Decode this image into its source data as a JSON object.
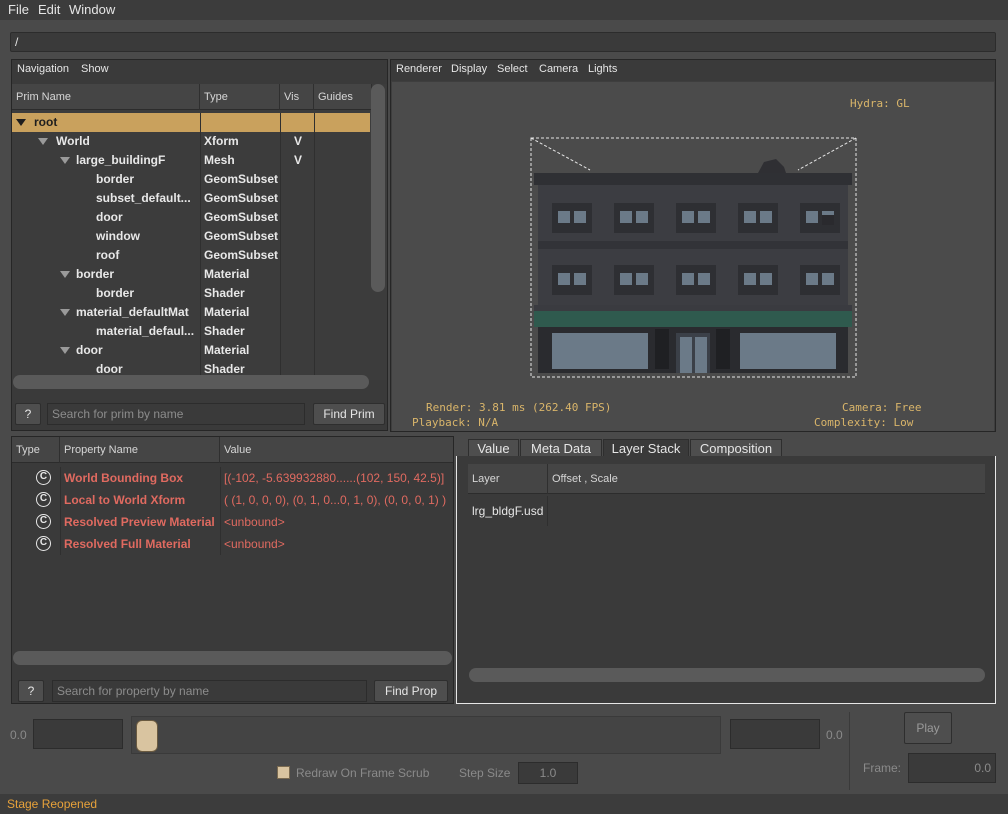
{
  "menubar": {
    "items": [
      "File",
      "Edit",
      "Window"
    ]
  },
  "path": "/",
  "prim_browser": {
    "menus": [
      "Navigation",
      "Show"
    ],
    "columns": [
      "Prim Name",
      "Type",
      "Vis",
      "Guides"
    ],
    "rows": [
      {
        "name": "root",
        "type": "",
        "vis": "",
        "level": 0,
        "expanded": true,
        "selected": true
      },
      {
        "name": "World",
        "type": "Xform",
        "vis": "V",
        "level": 1,
        "expanded": true
      },
      {
        "name": "large_buildingF",
        "type": "Mesh",
        "vis": "V",
        "level": 2,
        "expanded": true
      },
      {
        "name": "border",
        "type": "GeomSubset",
        "vis": "",
        "level": 3
      },
      {
        "name": "subset_default...",
        "type": "GeomSubset",
        "vis": "",
        "level": 3
      },
      {
        "name": "door",
        "type": "GeomSubset",
        "vis": "",
        "level": 3
      },
      {
        "name": "window",
        "type": "GeomSubset",
        "vis": "",
        "level": 3
      },
      {
        "name": "roof",
        "type": "GeomSubset",
        "vis": "",
        "level": 3
      },
      {
        "name": "border",
        "type": "Material",
        "vis": "",
        "level": 2,
        "expanded": true
      },
      {
        "name": "border",
        "type": "Shader",
        "vis": "",
        "level": 3
      },
      {
        "name": "material_defaultMat",
        "type": "Material",
        "vis": "",
        "level": 2,
        "expanded": true
      },
      {
        "name": "material_defaul...",
        "type": "Shader",
        "vis": "",
        "level": 3
      },
      {
        "name": "door",
        "type": "Material",
        "vis": "",
        "level": 2,
        "expanded": true
      },
      {
        "name": "door",
        "type": "Shader",
        "vis": "",
        "level": 3
      }
    ],
    "help_label": "?",
    "search_placeholder": "Search for prim by name",
    "find_label": "Find Prim"
  },
  "viewport": {
    "menus": [
      "Renderer",
      "Display",
      "Select",
      "Camera",
      "Lights"
    ],
    "hud": {
      "renderer": "Hydra: GL",
      "render_stats": "Render: 3.81 ms (262.40 FPS)",
      "playback": "Playback: N/A",
      "camera": "Camera: Free",
      "complexity": "Complexity: Low"
    }
  },
  "property_panel": {
    "columns": [
      "Type",
      "Property Name",
      "Value"
    ],
    "rows": [
      {
        "type_icon": "C",
        "name": "World Bounding Box",
        "value": "[(-102, -5.639932880......(102, 150, 42.5)]"
      },
      {
        "type_icon": "C",
        "name": "Local to World Xform",
        "value": "( (1, 0, 0, 0), (0, 1, 0...0, 1, 0), (0, 0, 0, 1) )"
      },
      {
        "type_icon": "C",
        "name": "Resolved Preview Material",
        "value": "<unbound>"
      },
      {
        "type_icon": "C",
        "name": "Resolved Full Material",
        "value": "<unbound>"
      }
    ],
    "help_label": "?",
    "search_placeholder": "Search for property by name",
    "find_label": "Find Prop"
  },
  "layer_panel": {
    "tabs": [
      "Value",
      "Meta Data",
      "Layer Stack",
      "Composition"
    ],
    "active_tab": "Layer Stack",
    "columns": [
      "Layer",
      "Offset , Scale"
    ],
    "rows": [
      {
        "layer": "lrg_bldgF.usd",
        "offset": ""
      }
    ]
  },
  "timeline": {
    "start_value": "0.0",
    "end_value": "0.0",
    "play_label": "Play",
    "redraw_label": "Redraw On Frame Scrub",
    "step_size_label": "Step Size",
    "step_size_value": "1.0",
    "frame_label": "Frame:",
    "frame_value": "0.0"
  },
  "status": {
    "text": "Stage Reopened"
  },
  "colors": {
    "accent": "#c9a15d",
    "property_red": "#e06a60",
    "hud_text": "#d9b56a",
    "status": "#e8a23a"
  }
}
